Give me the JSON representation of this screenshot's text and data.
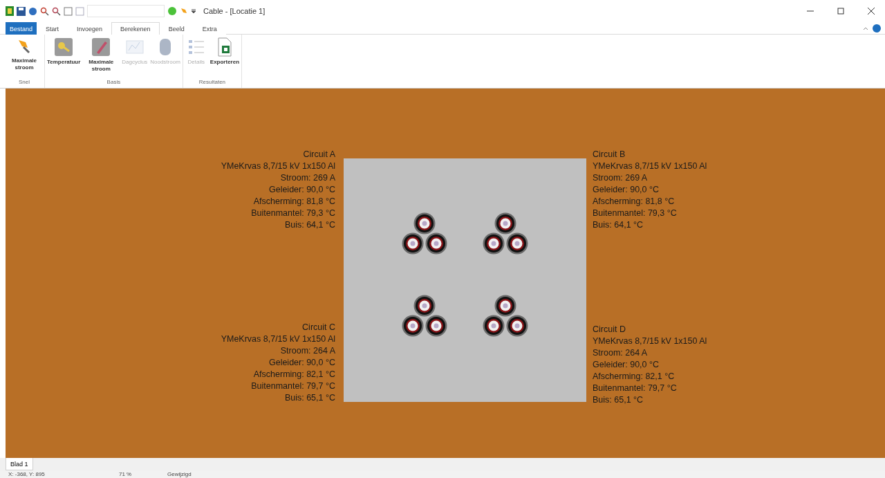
{
  "window": {
    "title": "Cable - [Locatie 1]"
  },
  "tabs": [
    {
      "label": "Bestand",
      "kind": "file",
      "selected": false
    },
    {
      "label": "Start",
      "kind": "tab",
      "selected": false
    },
    {
      "label": "Invoegen",
      "kind": "tab",
      "selected": false
    },
    {
      "label": "Berekenen",
      "kind": "tab",
      "selected": true
    },
    {
      "label": "Beeld",
      "kind": "tab",
      "selected": false
    },
    {
      "label": "Extra",
      "kind": "tab",
      "selected": false
    }
  ],
  "ribbon_groups": [
    {
      "label": "Snel",
      "buttons": [
        {
          "label": "Maximale stroom",
          "kind": "pin",
          "disabled": false
        }
      ]
    },
    {
      "label": "Basis",
      "buttons": [
        {
          "label": "Temperatuur",
          "kind": "keys",
          "disabled": false
        },
        {
          "label": "Maximale stroom",
          "kind": "pen",
          "disabled": false
        },
        {
          "label": "Dagcyclus",
          "kind": "chart",
          "disabled": true
        },
        {
          "label": "Noodstroom",
          "kind": "cylinder",
          "disabled": true
        }
      ]
    },
    {
      "label": "Resultaten",
      "buttons": [
        {
          "label": "Details",
          "kind": "list",
          "disabled": true
        },
        {
          "label": "Exporteren",
          "kind": "sheet",
          "disabled": false
        }
      ]
    }
  ],
  "circuits": [
    {
      "lines": [
        "Circuit A",
        "YMeKrvas 8,7/15 kV 1x150 Al",
        "Stroom: 269 A",
        "Geleider: 90,0 °C",
        "Afscherming: 81,8 °C",
        "Buitenmantel: 79,3 °C",
        "Buis: 64,1 °C"
      ]
    },
    {
      "lines": [
        "Circuit B",
        "YMeKrvas 8,7/15 kV 1x150 Al",
        "Stroom: 269 A",
        "Geleider: 90,0 °C",
        "Afscherming: 81,8 °C",
        "Buitenmantel: 79,3 °C",
        "Buis: 64,1 °C"
      ]
    },
    {
      "lines": [
        "Circuit C",
        "YMeKrvas 8,7/15 kV 1x150 Al",
        "Stroom: 264 A",
        "Geleider: 90,0 °C",
        "Afscherming: 82,1 °C",
        "Buitenmantel: 79,7 °C",
        "Buis: 65,1 °C"
      ]
    },
    {
      "lines": [
        "Circuit D",
        "YMeKrvas 8,7/15 kV 1x150 Al",
        "Stroom: 264 A",
        "Geleider: 90,0 °C",
        "Afscherming: 82,1 °C",
        "Buitenmantel: 79,7 °C",
        "Buis: 65,1 °C"
      ]
    }
  ],
  "sheet_tabs": [
    {
      "label": "Blad 1",
      "selected": true
    }
  ],
  "status_bar": {
    "coordinates": "X: -368, Y: 895",
    "zoom": "71 %",
    "state": "Gewijzigd"
  }
}
